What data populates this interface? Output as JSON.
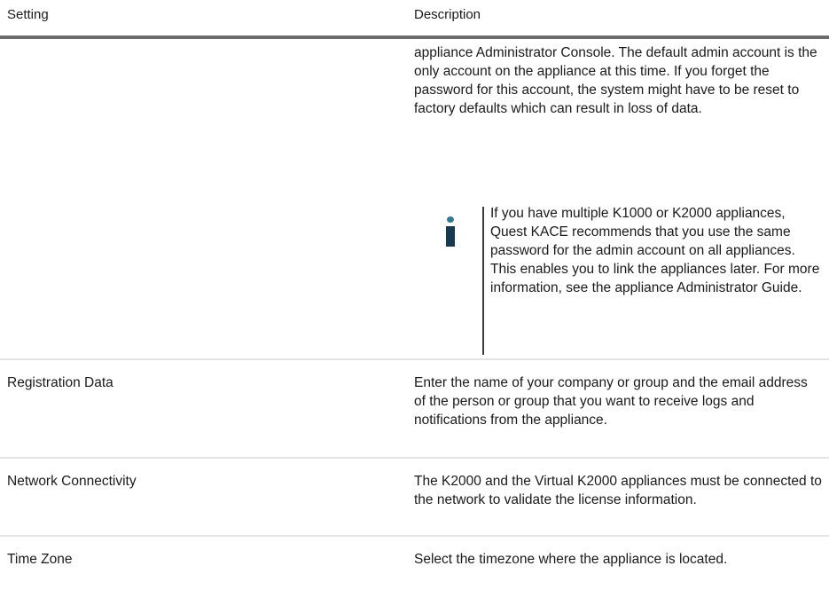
{
  "table": {
    "headers": {
      "setting": "Setting",
      "description": "Description"
    },
    "rows": [
      {
        "setting": "",
        "description": "appliance Administrator Console. The default admin account is the only account on the appliance at this time. If you forget the password for this account, the system might have to be reset to factory defaults which can result in loss of data.",
        "note": {
          "icon": "info-icon",
          "text": "If you have multiple K1000 or K2000 appliances, Quest KACE recommends that you use the same password for the admin account on all appliances. This enables you to link the appliances later. For more information, see the appliance Administrator Guide."
        }
      },
      {
        "setting": "Registration Data",
        "description": "Enter the name of your company or group and the email address of the person or group that you want to receive logs and notifications from the appliance."
      },
      {
        "setting": "Network Connectivity",
        "description": "The K2000 and the Virtual K2000 appliances must be connected to the network to validate the license information."
      },
      {
        "setting": "Time Zone",
        "description": "Select the timezone where the appliance is located."
      }
    ]
  },
  "colors": {
    "text": "#1a1a1a",
    "header_rule": "#6b6b6b",
    "row_divider": "#e3e3e3",
    "info_icon_dot": "#2d7a92",
    "info_icon_stem": "#163a52"
  }
}
